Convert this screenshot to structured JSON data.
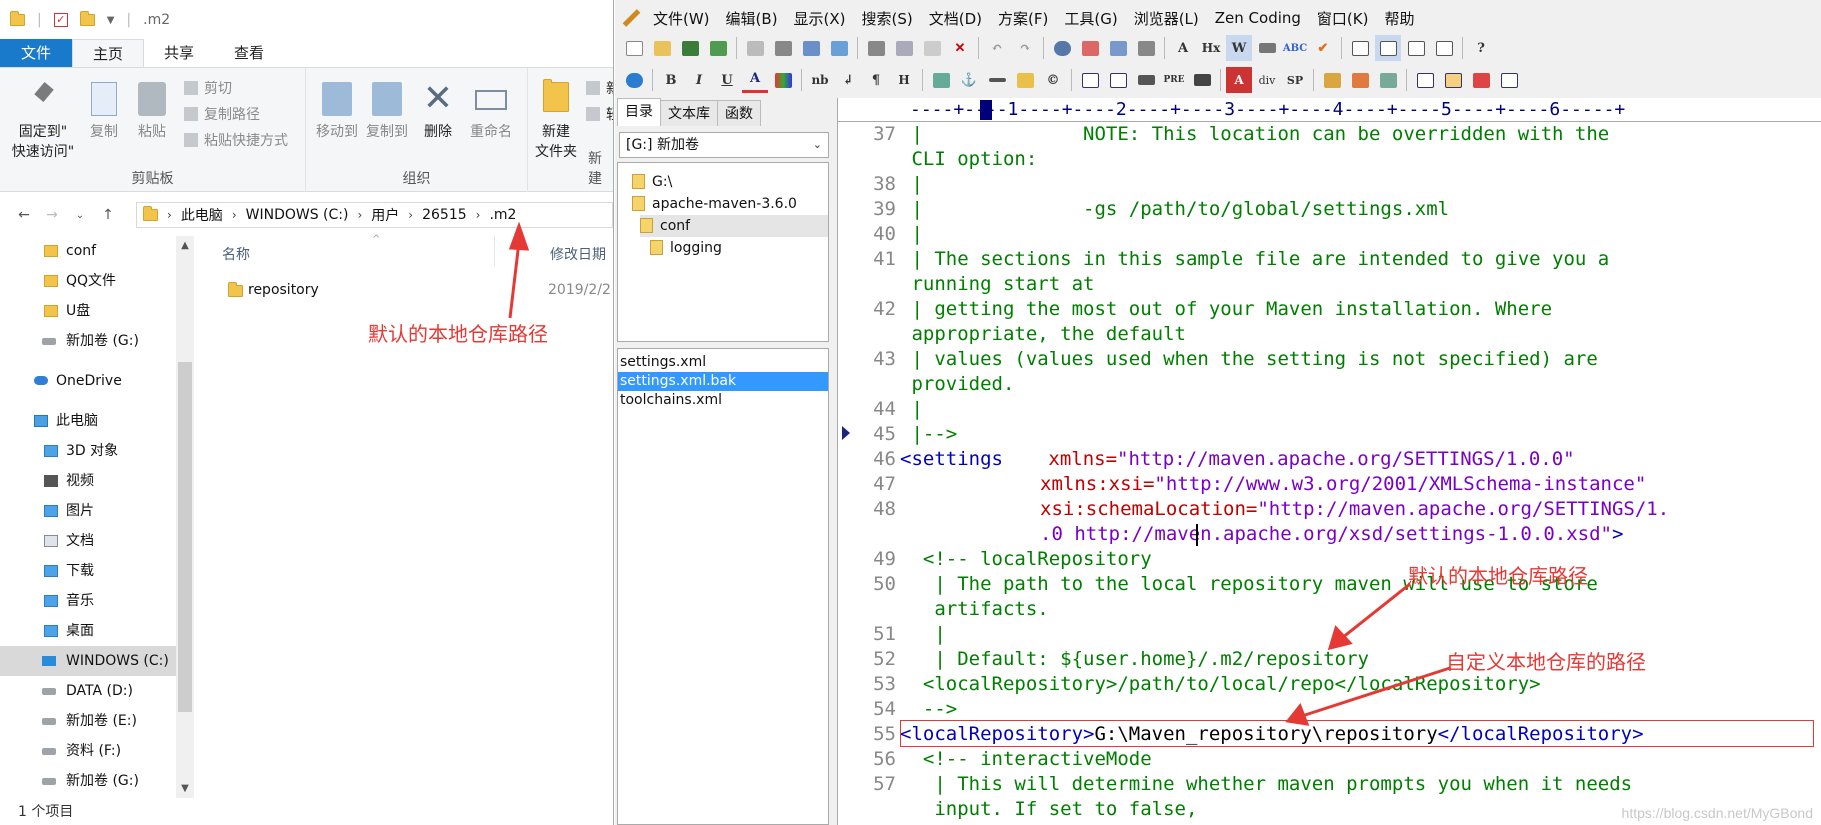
{
  "explorer": {
    "qat_title": ".m2",
    "tabs": [
      "文件",
      "主页",
      "共享",
      "查看"
    ],
    "ribbon": {
      "pin_label_1": "固定到\"",
      "pin_label_2": "快速访问\"",
      "copy": "复制",
      "paste": "粘贴",
      "cut": "剪切",
      "copy_path": "复制路径",
      "paste_shortcut": "粘贴快捷方式",
      "clipboard_group": "剪贴板",
      "move_to": "移动到",
      "copy_to": "复制到",
      "delete": "删除",
      "rename": "重命名",
      "organize_group": "组织",
      "new_folder_1": "新建",
      "new_folder_2": "文件夹",
      "new_group": "新建",
      "new_item_1": "新",
      "new_item_2": "轻"
    },
    "breadcrumb": [
      "此电脑",
      "WINDOWS (C:)",
      "用户",
      "26515",
      ".m2"
    ],
    "nav_items": [
      "conf",
      "QQ文件",
      "U盘",
      "新加卷 (G:)",
      "OneDrive",
      "此电脑",
      "3D 对象",
      "视频",
      "图片",
      "文档",
      "下载",
      "音乐",
      "桌面",
      "WINDOWS (C:)",
      "DATA (D:)",
      "新加卷 (E:)",
      "资料 (F:)",
      "新加卷 (G:)"
    ],
    "columns": {
      "name": "名称",
      "date": "修改日期"
    },
    "files": [
      {
        "name": "repository",
        "date": "2019/2/2"
      }
    ],
    "status": "1 个项目"
  },
  "editor": {
    "menu": [
      "文件(W)",
      "编辑(B)",
      "显示(X)",
      "搜索(S)",
      "文档(D)",
      "方案(F)",
      "工具(G)",
      "浏览器(L)",
      "Zen Coding",
      "窗口(K)",
      "帮助"
    ],
    "side_tabs": [
      "目录",
      "文本库",
      "函数"
    ],
    "drive": "[G:] 新加卷",
    "tree": [
      "G:\\",
      "apache-maven-3.6.0",
      "conf",
      "logging"
    ],
    "files": [
      "settings.xml",
      "settings.xml.bak",
      "toolchains.xml"
    ],
    "ruler": "----+----1----+----2----+----3----+----4----+----5----+----6-----+",
    "line_numbers": [
      "37",
      "38",
      "39",
      "40",
      "41",
      "42",
      "43",
      "44",
      "45",
      "46",
      "47",
      "48",
      "49",
      "50",
      "51",
      "52",
      "53",
      "54",
      "55",
      "56",
      "57"
    ],
    "code": {
      "l37a": " |              NOTE: This location can be overridden with the",
      "l37b": " CLI option:",
      "l38": " |",
      "l39": " |              -gs /path/to/global/settings.xml",
      "l40": " |",
      "l41a": " | The sections in this sample file are intended to give you a",
      "l41b": " running start at",
      "l42a": " | getting the most out of your Maven installation. Where",
      "l42b": " appropriate, the default",
      "l43a": " | values (values used when the setting is not specified) are",
      "l43b": " provided.",
      "l44": " |",
      "l45": " |-->",
      "l46_tag": "<settings ",
      "l46_attr": "xmlns=",
      "l46_val": "\"http://maven.apache.org/SETTINGS/1.0.0\"",
      "l47_attr": "xmlns:xsi=",
      "l47_val": "\"http://www.w3.org/2001/XMLSchema-instance\"",
      "l48_attr": "xsi:schemaLocation=",
      "l48_val_a": "\"http://maven.apache.org/SETTINGS/1.",
      "l48_val_b": ".0 http://maven.apache.org/xsd/settings-1.0.0.xsd\"",
      "l48_end": ">",
      "l49": "  <!-- localRepository",
      "l50a": "   | The path to the local repository maven will use to store",
      "l50b": "   artifacts.",
      "l51": "   |",
      "l52": "   | Default: ${user.home}/.m2/repository",
      "l53": "  <localRepository>/path/to/local/repo</localRepository>",
      "l54": "  -->",
      "l55_open": "<localRepository>",
      "l55_val": "G:\\Maven_repository\\repository",
      "l55_close": "</localRepository>",
      "l56": "  <!-- interactiveMode",
      "l57a": "   | This will determine whether maven prompts you when it needs",
      "l57b": "   input. If set to false,"
    }
  },
  "annotations": {
    "left": "默认的本地仓库路径",
    "right_top": "默认的本地仓库路径",
    "right_bottom": "自定义本地仓库的路径",
    "color": "#e53935"
  },
  "watermark": "https://blog.csdn.net/MyGBond"
}
